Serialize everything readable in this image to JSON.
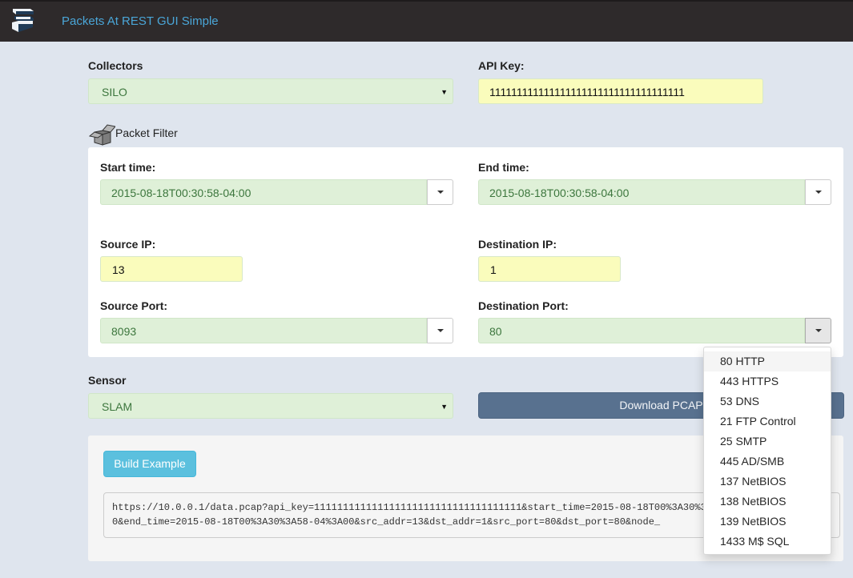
{
  "app": {
    "title": "Packets At REST GUI Simple",
    "logo_icon": "books-stack-icon"
  },
  "collectors": {
    "label": "Collectors",
    "value": "SILO"
  },
  "api_key": {
    "label": "API Key:",
    "value": "111111111111111111111111111111111111"
  },
  "packet_filter": {
    "title": "Packet Filter",
    "icon": "open-box-icon",
    "start_time": {
      "label": "Start time:",
      "value": "2015-08-18T00:30:58-04:00"
    },
    "end_time": {
      "label": "End time:",
      "value": "2015-08-18T00:30:58-04:00"
    },
    "source_ip": {
      "label": "Source IP:",
      "value": "13"
    },
    "destination_ip": {
      "label": "Destination IP:",
      "value": "1"
    },
    "source_port": {
      "label": "Source Port:",
      "value": "8093"
    },
    "destination_port": {
      "label": "Destination Port:",
      "value": "80"
    }
  },
  "sensor": {
    "label": "Sensor",
    "value": "SLAM"
  },
  "download_button": "Download PCAP",
  "build_button": "Build Example",
  "example_url": {
    "line1": "https://10.0.0.1/data.pcap?api_key=111111111111111111111111111111111111&start_time=2015-08-18T00%3A30%3A58-04%3A0",
    "line2": "0&end_time=2015-08-18T00%3A30%3A58-04%3A00&src_addr=13&dst_addr=1&src_port=80&dst_port=80&node_"
  },
  "port_dropdown": {
    "items": [
      "80 HTTP",
      "443 HTTPS",
      "53 DNS",
      "21 FTP Control",
      "25 SMTP",
      "445 AD/SMB",
      "137 NetBIOS",
      "138 NetBIOS",
      "139 NetBIOS",
      "1433 M$ SQL"
    ],
    "highlighted_index": 0
  },
  "colors": {
    "navbar": "#2e2a2b",
    "brand": "#4aa6d8",
    "valid_field": "#dff0d8",
    "highlight_field": "#fafcbc",
    "download_button": "#58718f",
    "build_button": "#5bc0de"
  }
}
